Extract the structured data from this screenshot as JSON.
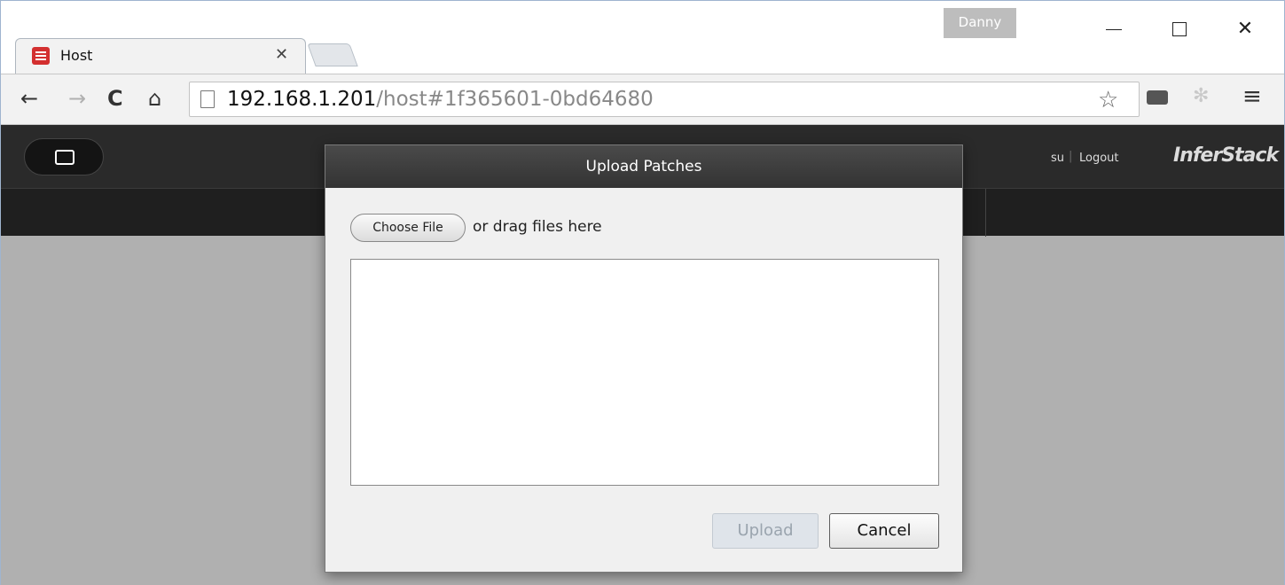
{
  "browser": {
    "profile_name": "Danny",
    "tab": {
      "title": "Host",
      "close_glyph": "✕"
    },
    "url_host": "192.168.1.201",
    "url_path": "/host#1f365601-0bd64680",
    "icons": {
      "back": "←",
      "forward": "→",
      "reload": "C",
      "home": "⌂",
      "star": "☆",
      "extension": "✻",
      "menu": "≡",
      "window_close": "✕"
    }
  },
  "app": {
    "user": "su",
    "separator": "|",
    "logout_label": "Logout",
    "brand": "InferStack"
  },
  "modal": {
    "title": "Upload Patches",
    "choose_file_label": "Choose File",
    "drag_text": "or drag files here",
    "upload_label": "Upload",
    "cancel_label": "Cancel"
  }
}
